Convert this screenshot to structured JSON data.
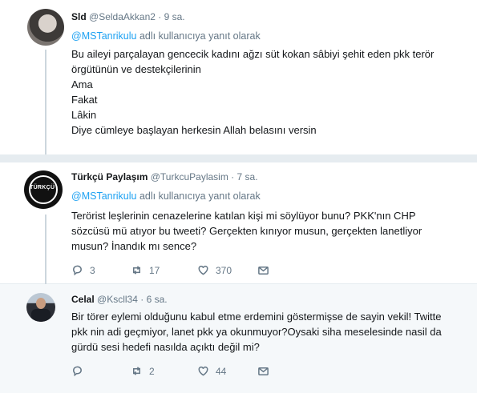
{
  "tweets": [
    {
      "name": "Sld",
      "handle": "@SeldaAkkan2",
      "time": "9 sa.",
      "reply_mention": "@MSTanrikulu",
      "reply_suffix": "adlı kullanıcıya yanıt olarak",
      "lines": [
        "Bu aileyi parçalayan gencecik kadını ağzı süt kokan sâbiyi şehit eden pkk terör",
        "örgütünün ve destekçilerinin",
        "Ama",
        "Fakat",
        "Lâkin",
        "Diye cümleye başlayan herkesin Allah belasını versin"
      ]
    },
    {
      "name": "Türkçü Paylaşım",
      "handle": "@TurkcuPaylasim",
      "time": "7 sa.",
      "avatar_text": "TÜRKÇÜ",
      "reply_mention": "@MSTanrikulu",
      "reply_suffix": "adlı kullanıcıya yanıt olarak",
      "lines": [
        "Terörist leşlerinin cenazelerine katılan kişi mi söylüyor bunu? PKK'nın CHP",
        "sözcüsü mü atıyor bu tweeti? Gerçekten kınıyor musun, gerçekten lanetliyor",
        "musun? İnandık mı sence?"
      ],
      "replies": "3",
      "retweets": "17",
      "likes": "370"
    },
    {
      "name": "Celal",
      "handle": "@Kscll34",
      "time": "6 sa.",
      "lines": [
        "Bir törer eylemi olduğunu kabul etme erdemini göstermişse de sayin vekil! Twitte",
        "pkk nin adi geçmiyor, lanet pkk ya okunmuyor?Oysaki siha meselesinde nasil da",
        "gürdü sesi hedefi nasılda açıktı değil mi?"
      ],
      "replies": "",
      "retweets": "2",
      "likes": "44"
    }
  ],
  "icons": {
    "reply": "reply-icon",
    "retweet": "retweet-icon",
    "like": "heart-icon",
    "dm": "envelope-icon"
  },
  "colors": {
    "link": "#1da1f2",
    "muted": "#657786",
    "separator": "#e6ecf0",
    "highlight_bg": "#f5f8fa"
  }
}
